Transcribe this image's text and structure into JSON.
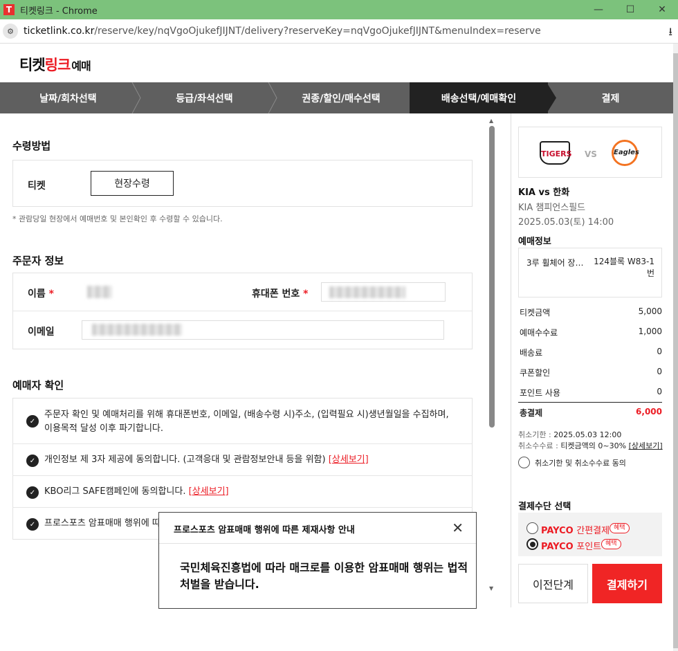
{
  "browser": {
    "tab_title": "티켓링크 - Chrome",
    "favicon_glyph": "T",
    "url_host": "ticketlink.co.kr",
    "url_path": "/reserve/key/nqVgoOjukefJIJNT/delivery?reserveKey=nqVgoOjukefJIJNT&menuIndex=reserve",
    "minimize_glyph": "—",
    "maximize_glyph": "☐",
    "close_glyph": "✕",
    "download_glyph": "⭳"
  },
  "logo": {
    "part1": "티켓",
    "part2": "링크",
    "part3": "예매"
  },
  "steps": [
    {
      "label": "날짜/회차선택"
    },
    {
      "label": "등급/좌석선택"
    },
    {
      "label": "권종/할인/매수선택"
    },
    {
      "label": "배송선택/예매확인"
    },
    {
      "label": "결제"
    }
  ],
  "receive": {
    "title": "수령방법",
    "ticket_label": "티켓",
    "pickup_button": "현장수령",
    "note": "* 관람당일 현장에서 예매번호 및 본인확인 후 수령할 수 있습니다."
  },
  "orderer": {
    "title": "주문자 정보",
    "name_label": "이름",
    "phone_label": "휴대폰 번호",
    "email_label": "이메일",
    "required_mark": "*"
  },
  "confirm": {
    "title": "예매자 확인",
    "items": [
      {
        "line1": "주문자 확인 및 예매처리를 위해 휴대폰번호, 이메일, (배송수령 시)주소, (입력필요 시)생년월일을 수집하며,",
        "line2": "이용목적 달성 이후 파기합니다."
      },
      {
        "text": "개인정보 제 3자 제공에 동의합니다. (고객응대 및 관람정보안내 등을 위함)",
        "link": "[상세보기]"
      },
      {
        "text": "KBO리그 SAFE캠페인에 동의합니다.",
        "link": "[상세보기]"
      },
      {
        "text": "프로스포츠 암표매매 행위에 따른"
      }
    ],
    "check_glyph": "✓"
  },
  "modal": {
    "title": "프로스포츠 암표매매 행위에 따른 제재사항 안내",
    "close_glyph": "✕",
    "body": "국민체육진흥법에 따라 매크로를 이용한 암표매매 행위는 법적 처벌을 받습니다."
  },
  "game": {
    "home_logo": "TIGERS",
    "vs": "VS",
    "away_logo": "Eagles",
    "title": "KIA vs 한화",
    "venue": "KIA 챔피언스필드",
    "datetime": "2025.05.03(토) 14:00"
  },
  "reserve_info": {
    "title": "예매정보",
    "seat_grade": "3루 휠체어 장…",
    "seat_no_line1": "124블록 W83-1",
    "seat_no_line2": "번"
  },
  "prices": [
    {
      "label": "티켓금액",
      "value": "5,000"
    },
    {
      "label": "예매수수료",
      "value": "1,000"
    },
    {
      "label": "배송료",
      "value": "0"
    },
    {
      "label": "쿠폰할인",
      "value": "0"
    },
    {
      "label": "포인트 사용",
      "value": "0"
    }
  ],
  "total": {
    "label": "총결제",
    "value": "6,000",
    "color": "#ec1c24"
  },
  "cancel": {
    "deadline_label": "취소기한 : ",
    "deadline_value": "2025.05.03 12:00",
    "fee_label": "취소수수료 : ",
    "fee_value": "티켓금액의 0~30%",
    "fee_link": "[상세보기]",
    "agree_label": "취소기한 및 취소수수료 동의"
  },
  "payment": {
    "title": "결제수단 선택",
    "options": [
      {
        "brand": "PAYCO",
        "sub": "간편결제",
        "badge": "혜택",
        "selected": false
      },
      {
        "brand": "PAYCO",
        "sub": "포인트",
        "badge": "혜택",
        "selected": true
      }
    ]
  },
  "buttons": {
    "prev": "이전단계",
    "pay": "결제하기"
  },
  "colors": {
    "accent": "#ec1c24",
    "nav_bg": "#5f5f5f",
    "nav_active": "#222222",
    "chrome_bar": "#7cc27c"
  }
}
